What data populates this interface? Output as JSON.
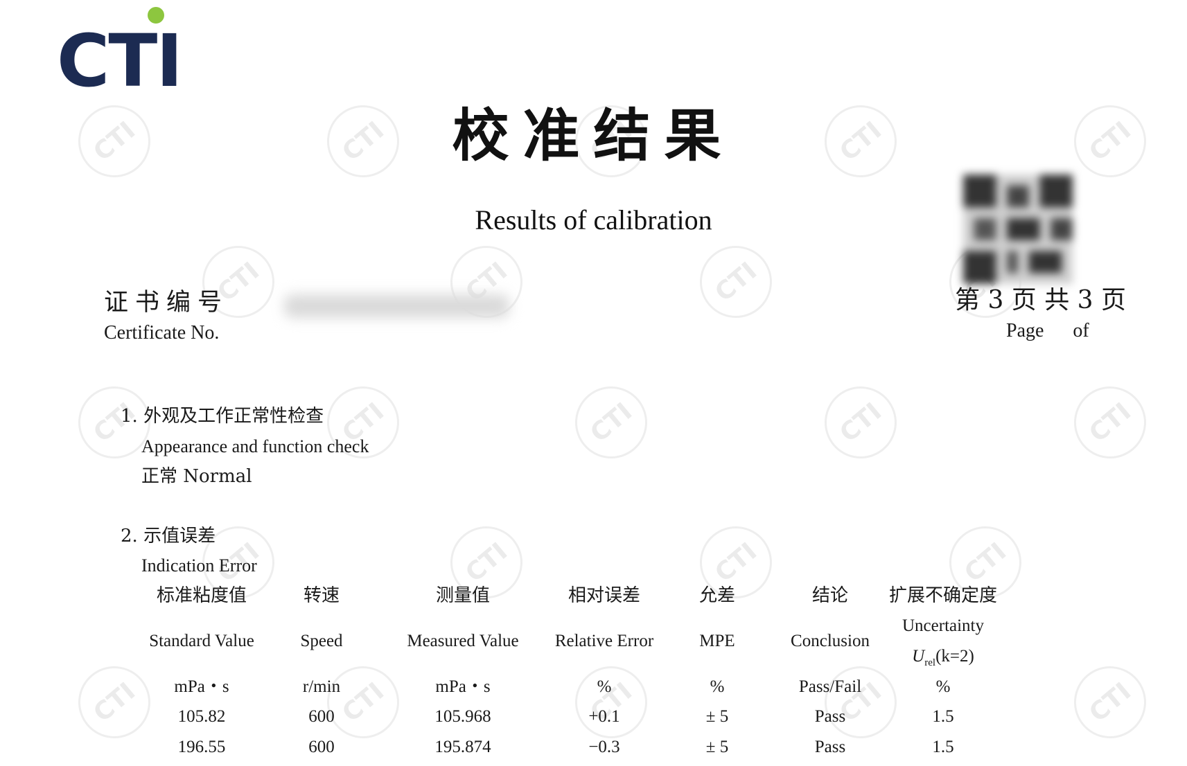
{
  "logo": {
    "text": "CTI"
  },
  "watermark": {
    "text": "CTI"
  },
  "title": {
    "cn": "校准结果",
    "en": "Results of calibration"
  },
  "certificate": {
    "label_cn": "证书编号",
    "label_en": "Certificate No."
  },
  "page": {
    "cn": "第 3 页 共 3 页",
    "en": "Page      of"
  },
  "section1": {
    "title_cn": "1. 外观及工作正常性检查",
    "title_en": "Appearance and function check",
    "result": "正常 Normal"
  },
  "section2": {
    "title_cn": "2. 示值误差",
    "title_en": "Indication Error"
  },
  "table": {
    "headers_cn": [
      "标准粘度值",
      "转速",
      "测量值",
      "相对误差",
      "允差",
      "结论",
      "扩展不确定度"
    ],
    "headers_en": [
      "Standard Value",
      "Speed",
      "Measured Value",
      "Relative Error",
      "MPE",
      "Conclusion",
      "Uncertainty"
    ],
    "uncertainty_symbol": {
      "u": "U",
      "sub": "rel",
      "k": "(k=2)"
    },
    "units": [
      "mPa・s",
      "r/min",
      "mPa・s",
      "%",
      "%",
      "Pass/Fail",
      "%"
    ],
    "rows": [
      [
        "105.82",
        "600",
        "105.968",
        "+0.1",
        "± 5",
        "Pass",
        "1.5"
      ],
      [
        "196.55",
        "600",
        "195.874",
        "−0.3",
        "± 5",
        "Pass",
        "1.5"
      ]
    ]
  }
}
